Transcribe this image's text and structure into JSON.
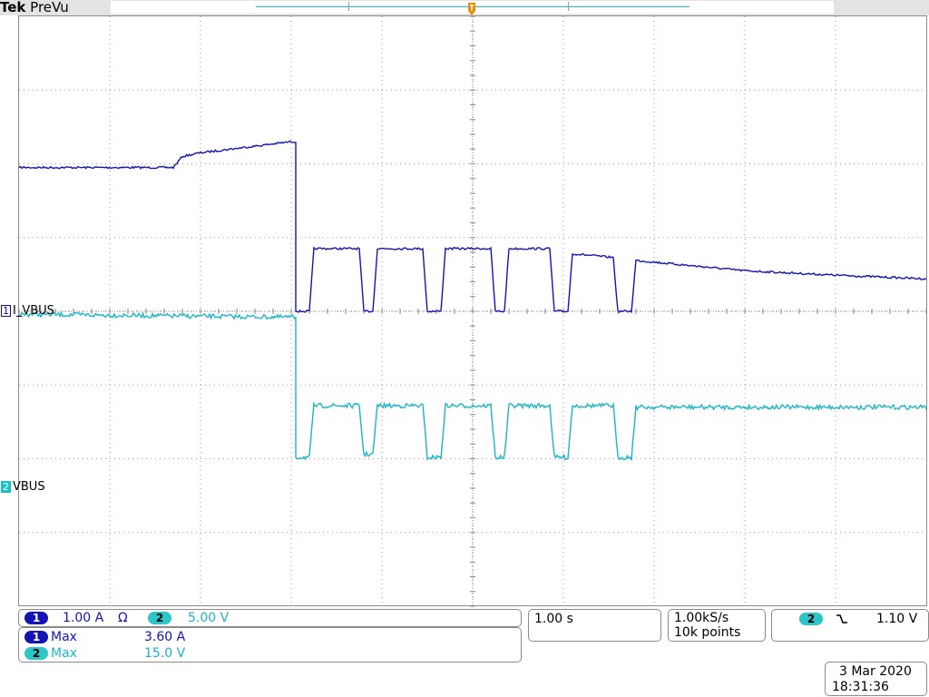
{
  "brand": {
    "name": "Tek",
    "mode": "PreVu"
  },
  "channels": [
    {
      "id": "1",
      "label": "I_VBUS",
      "color": "#1414b4"
    },
    {
      "id": "2",
      "label": "VBUS",
      "color": "#1cb4c8"
    }
  ],
  "scale_panel": {
    "ch1_num": "1",
    "ch1_scale": "1.00 A",
    "ch1_coupling_icon": "ohm-icon",
    "ch1_coupling": "Ω",
    "ch2_num": "2",
    "ch2_scale": "5.00 V"
  },
  "measurements": [
    {
      "ch": "1",
      "name": "Max",
      "value": "3.60 A"
    },
    {
      "ch": "2",
      "name": "Max",
      "value": "15.0 V"
    }
  ],
  "timebase": {
    "per_div": "1.00 s"
  },
  "acquisition": {
    "sample_rate": "1.00kS/s",
    "record_length": "10k points"
  },
  "trigger": {
    "source": "2",
    "slope_icon": "falling-edge-icon",
    "slope": "↘",
    "level": "1.10 V"
  },
  "datetime": {
    "date": "3 Mar  2020",
    "time": "18:31:36"
  },
  "chart_data": {
    "type": "line",
    "x_unit": "s",
    "xlim": [
      -5,
      5
    ],
    "grid": true,
    "series": [
      {
        "name": "I_VBUS",
        "channel": "1",
        "unit": "A",
        "zero_div": 0,
        "points": [
          [
            -5,
            1.95
          ],
          [
            -3.3,
            1.95
          ],
          [
            -3.2,
            2.1
          ],
          [
            -3.0,
            2.15
          ],
          [
            -2.0,
            2.3
          ],
          [
            -1.95,
            2.3
          ],
          [
            -1.95,
            0
          ],
          [
            -1.8,
            0
          ],
          [
            -1.75,
            0.85
          ],
          [
            -1.25,
            0.85
          ],
          [
            -1.2,
            0
          ],
          [
            -1.1,
            0
          ],
          [
            -1.05,
            0.85
          ],
          [
            -0.55,
            0.85
          ],
          [
            -0.5,
            0
          ],
          [
            -0.35,
            0
          ],
          [
            -0.3,
            0.85
          ],
          [
            0.2,
            0.85
          ],
          [
            0.25,
            0
          ],
          [
            0.35,
            0
          ],
          [
            0.4,
            0.85
          ],
          [
            0.85,
            0.85
          ],
          [
            0.9,
            0
          ],
          [
            1.05,
            0
          ],
          [
            1.1,
            0.78
          ],
          [
            1.55,
            0.73
          ],
          [
            1.6,
            0
          ],
          [
            1.75,
            0
          ],
          [
            1.8,
            0.69
          ],
          [
            3.0,
            0.55
          ],
          [
            4.0,
            0.49
          ],
          [
            5,
            0.44
          ]
        ]
      },
      {
        "name": "VBUS",
        "channel": "2",
        "unit": "V",
        "zero_div": -2,
        "points": [
          [
            -5,
            9.8
          ],
          [
            -2.0,
            9.6
          ],
          [
            -1.95,
            9.6
          ],
          [
            -1.95,
            0.1
          ],
          [
            -1.8,
            0.1
          ],
          [
            -1.75,
            3.6
          ],
          [
            -1.25,
            3.6
          ],
          [
            -1.2,
            0.3
          ],
          [
            -1.1,
            0.3
          ],
          [
            -1.05,
            3.6
          ],
          [
            -0.55,
            3.6
          ],
          [
            -0.5,
            0.1
          ],
          [
            -0.35,
            0.1
          ],
          [
            -0.3,
            3.6
          ],
          [
            0.2,
            3.6
          ],
          [
            0.25,
            0.1
          ],
          [
            0.35,
            0.1
          ],
          [
            0.4,
            3.6
          ],
          [
            0.85,
            3.6
          ],
          [
            0.9,
            0.1
          ],
          [
            1.05,
            0.1
          ],
          [
            1.1,
            3.6
          ],
          [
            1.55,
            3.6
          ],
          [
            1.6,
            0.1
          ],
          [
            1.75,
            0.1
          ],
          [
            1.8,
            3.5
          ],
          [
            5,
            3.5
          ]
        ]
      }
    ],
    "volts_per_div": [
      1.0,
      5.0
    ]
  }
}
